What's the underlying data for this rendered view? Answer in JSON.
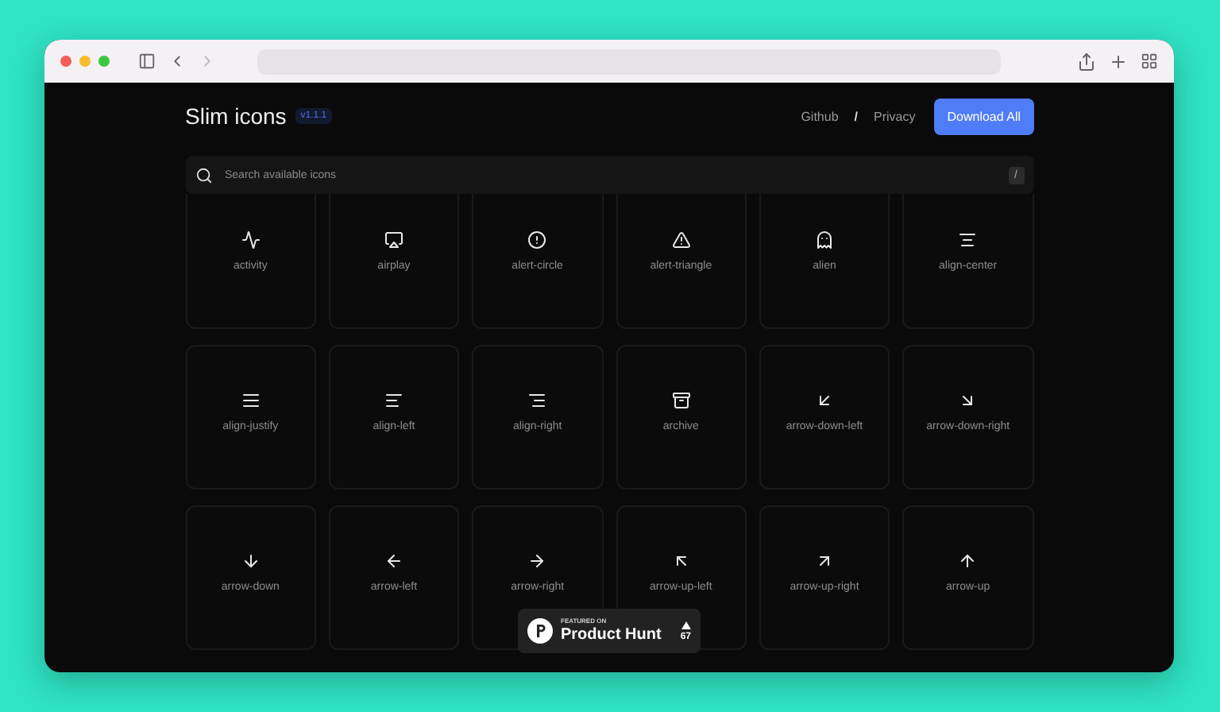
{
  "header": {
    "title": "Slim icons",
    "version": "v1.1.1",
    "links": [
      "Github",
      "/",
      "Privacy"
    ],
    "download_button": "Download All"
  },
  "search": {
    "placeholder": "Search available icons",
    "shortcut": "/"
  },
  "icons": [
    {
      "label": "activity"
    },
    {
      "label": "airplay"
    },
    {
      "label": "alert-circle"
    },
    {
      "label": "alert-triangle"
    },
    {
      "label": "alien"
    },
    {
      "label": "align-center"
    },
    {
      "label": "align-justify"
    },
    {
      "label": "align-left"
    },
    {
      "label": "align-right"
    },
    {
      "label": "archive"
    },
    {
      "label": "arrow-down-left"
    },
    {
      "label": "arrow-down-right"
    },
    {
      "label": "arrow-down"
    },
    {
      "label": "arrow-left"
    },
    {
      "label": "arrow-right"
    },
    {
      "label": "arrow-up-left"
    },
    {
      "label": "arrow-up-right"
    },
    {
      "label": "arrow-up"
    }
  ],
  "badge": {
    "caption": "FEATURED ON",
    "name": "Product Hunt",
    "votes": "67"
  }
}
